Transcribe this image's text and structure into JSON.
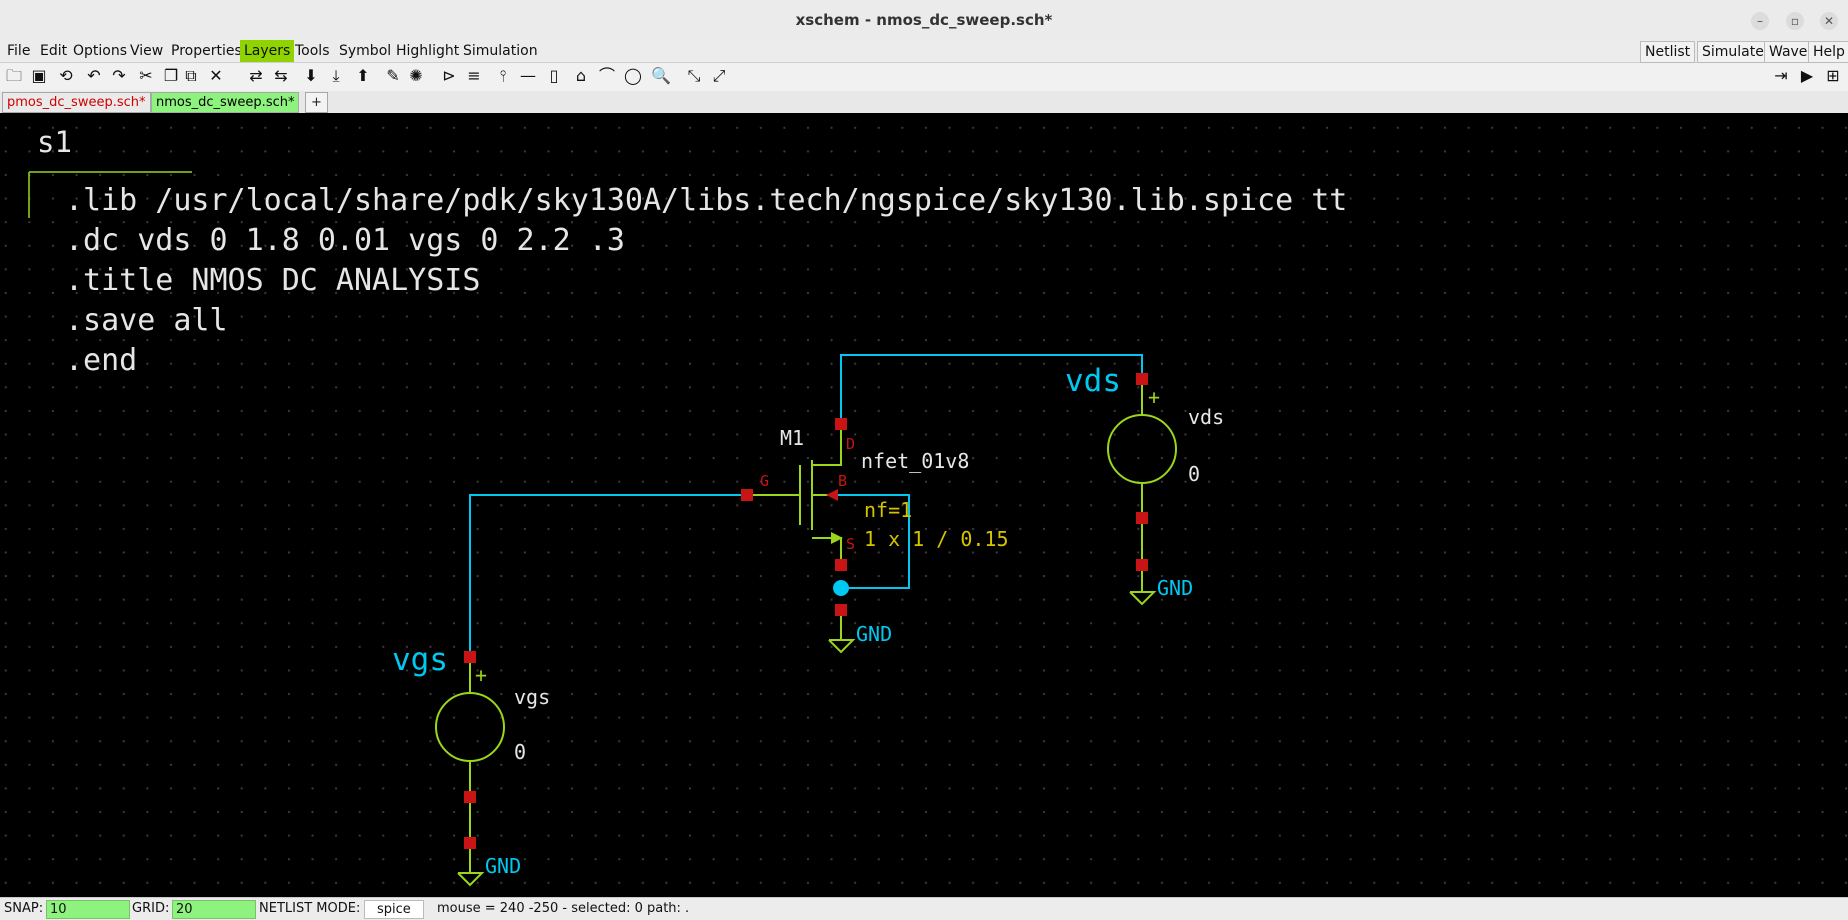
{
  "window": {
    "title": "xschem - nmos_dc_sweep.sch*",
    "minimize_icon": "minimize-icon",
    "maximize_icon": "maximize-icon",
    "close_icon": "close-icon"
  },
  "menu": {
    "items": [
      "File",
      "Edit",
      "Options",
      "View",
      "Properties",
      "Layers",
      "Tools",
      "Symbol",
      "Highlight",
      "Simulation"
    ],
    "active": "Layers",
    "right_items": [
      "Netlist",
      "Simulate",
      "Waves",
      "Help"
    ]
  },
  "toolbar": {
    "icons": [
      "open-folder-icon",
      "save-icon",
      "reload-icon",
      "undo-icon",
      "redo-icon",
      "cut-icon",
      "copy-icon",
      "paste-icon",
      "delete-icon",
      "move-icon",
      "duplicate-icon",
      "descend-icon",
      "descend-symbol-icon",
      "ascend-icon",
      "wire-icon",
      "highlight-icon",
      "insert-symbol-icon",
      "pin-label-icon",
      "probe-icon",
      "line-icon",
      "rectangle-icon",
      "polygon-icon",
      "arc-icon",
      "circle-icon",
      "zoom-icon",
      "zoom-in-icon",
      "zoom-full-icon"
    ],
    "right_icons": [
      "netlist-icon",
      "simulate-icon",
      "waves-icon"
    ]
  },
  "tabs": {
    "items": [
      {
        "label": "pmos_dc_sweep.sch*",
        "color": "#d00000"
      },
      {
        "label": "nmos_dc_sweep.sch*",
        "color": "#000000"
      }
    ],
    "add_label": "+"
  },
  "schematic": {
    "code_block_name": "s1",
    "code_lines": [
      ".lib /usr/local/share/pdk/sky130A/libs.tech/ngspice/sky130.lib.spice tt",
      ".dc vds 0 1.8 0.01 vgs 0 2.2 .3",
      ".title NMOS DC ANALYSIS",
      ".save all",
      ".end"
    ],
    "transistor": {
      "name": "M1",
      "model": "nfet_01v8",
      "nf": "nf=1",
      "size": "1 x 1 / 0.15",
      "pins": {
        "d": "D",
        "g": "G",
        "b": "B",
        "s": "S"
      }
    },
    "vds_source": {
      "net_label": "vds",
      "name": "vds",
      "value": "0",
      "plus": "+"
    },
    "vgs_source": {
      "net_label": "vgs",
      "name": "vgs",
      "value": "0",
      "plus": "+"
    },
    "gnd_label": "GND",
    "colors": {
      "wire": "#00c8f0",
      "symbol": "#9bd61a",
      "pin": "#c81414",
      "text": "#e6e6e6",
      "attr": "#d4c400"
    }
  },
  "status": {
    "snap_label": "SNAP:",
    "snap_value": "10",
    "grid_label": "GRID:",
    "grid_value": "20",
    "netlist_label": "NETLIST MODE:",
    "netlist_value": "spice",
    "info": "mouse = 240 -250 - selected: 0 path: ."
  }
}
